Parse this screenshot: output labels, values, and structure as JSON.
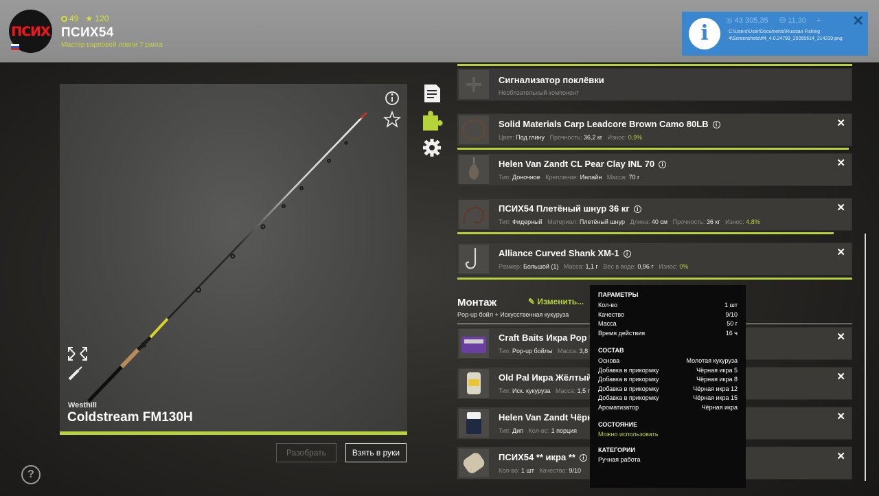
{
  "profile": {
    "avatar_text": "ПСИХ",
    "coins": "49",
    "stars": "120",
    "username": "ПСИХ54",
    "rank": "Мастер карповой ловли 7 ранга"
  },
  "notification": {
    "ghost_money": "43 305,35",
    "ghost_gold": "11,30",
    "path": "C:\\Users\\User\\Documents\\Russian Fishing 4\\Screenshots\\rf4_4.0.24799_20260614_214239.png",
    "close": "✕"
  },
  "rod": {
    "brand": "Westhill",
    "name": "Coldstream FM130H"
  },
  "buttons": {
    "disassemble": "Разобрать",
    "take_in_hands": "Взять в руки"
  },
  "components": [
    {
      "title": "Сигнализатор поклёвки",
      "subtitle": "Необязательный компонент"
    },
    {
      "title": "Solid Materials Carp Leadcore Brown Camo 80LB",
      "props": [
        {
          "k": "Цвет:",
          "v": "Под глину"
        },
        {
          "k": "Прочность:",
          "v": "36,2 кг"
        },
        {
          "k": "Износ:",
          "v": "0,9%"
        }
      ]
    },
    {
      "title": "Helen Van Zandt CL Pear Clay INL 70",
      "props": [
        {
          "k": "Тип:",
          "v": "Доночное"
        },
        {
          "k": "Крепление:",
          "v": "Инлайн"
        },
        {
          "k": "Масса:",
          "v": "70 г"
        }
      ]
    },
    {
      "title": "ПСИХ54 Плетёный шнур 36 кг",
      "props": [
        {
          "k": "Тип:",
          "v": "Фидерный"
        },
        {
          "k": "Материал:",
          "v": "Плетёный шнур"
        },
        {
          "k": "Длина:",
          "v": "40 см"
        },
        {
          "k": "Прочность:",
          "v": "36 кг"
        },
        {
          "k": "Износ:",
          "v": "4,8%"
        }
      ]
    },
    {
      "title": "Alliance Curved Shank XM-1",
      "props": [
        {
          "k": "Размер:",
          "v": "Большой (1)"
        },
        {
          "k": "Масса:",
          "v": "1,1 г"
        },
        {
          "k": "Вес в воде:",
          "v": "0,96 г"
        },
        {
          "k": "Износ:",
          "v": "0%"
        }
      ]
    }
  ],
  "montage": {
    "title": "Монтаж",
    "subtitle": "Pop-up бойл + Искусственная кукуруза",
    "edit": "Изменить..."
  },
  "baits": [
    {
      "title": "Craft Baits Икра Pop U",
      "props": [
        {
          "k": "Тип:",
          "v": "Pop-up бойлы"
        },
        {
          "k": "Масса:",
          "v": "3,8"
        }
      ]
    },
    {
      "title": "Old Pal Икра Жёлтый",
      "props": [
        {
          "k": "Тип:",
          "v": "Иск. кукуруза"
        },
        {
          "k": "Масса:",
          "v": "1,5 г"
        }
      ]
    },
    {
      "title": "Helen Van Zandt Чёрн",
      "props": [
        {
          "k": "Тип:",
          "v": "Дип"
        },
        {
          "k": "Кол-во:",
          "v": "1 порция"
        }
      ]
    },
    {
      "title": "ПСИХ54 ** икра **",
      "props": [
        {
          "k": "Кол-во:",
          "v": "1 шт"
        },
        {
          "k": "Качество:",
          "v": "9/10"
        }
      ]
    }
  ],
  "tooltip": {
    "params_title": "ПАРАМЕТРЫ",
    "params": [
      {
        "k": "Кол-во",
        "v": "1 шт"
      },
      {
        "k": "Качество",
        "v": "9/10"
      },
      {
        "k": "Масса",
        "v": "50 г"
      },
      {
        "k": "Время действия",
        "v": "16 ч"
      }
    ],
    "composition_title": "СОСТАВ",
    "composition": [
      {
        "k": "Основа",
        "v": "Молотая кукуруза"
      },
      {
        "k": "Добавка в прикормку",
        "v": "Чёрная икра 5"
      },
      {
        "k": "Добавка в прикормку",
        "v": "Чёрная икра 8"
      },
      {
        "k": "Добавка в прикормку",
        "v": "Чёрная икра 12"
      },
      {
        "k": "Добавка в прикормку",
        "v": "Чёрная икра 15"
      },
      {
        "k": "Ароматизатор",
        "v": "Чёрная икра"
      }
    ],
    "state_title": "СОСТОЯНИЕ",
    "state": "Можно использовать",
    "category_title": "КАТЕГОРИИ",
    "category": "Ручная работа"
  },
  "colors": {
    "accent": "#b6d33a",
    "notification": "#3a86cf",
    "topbar": "#939393"
  },
  "help": "?"
}
